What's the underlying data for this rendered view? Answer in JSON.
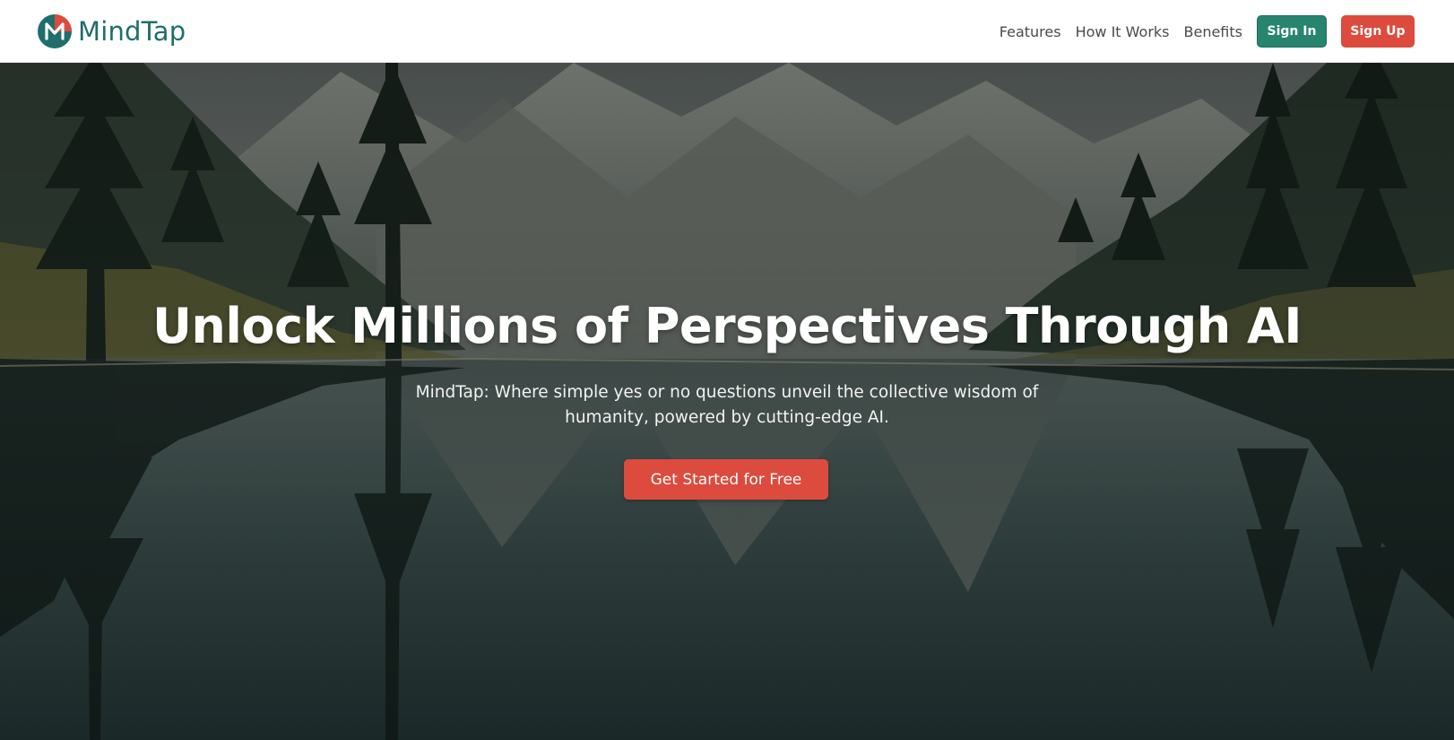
{
  "header": {
    "brand_name": "MindTap",
    "logo_letter": "M",
    "nav": {
      "features": "Features",
      "how_it_works": "How It Works",
      "benefits": "Benefits"
    },
    "sign_in": "Sign In",
    "sign_up": "Sign Up"
  },
  "hero": {
    "title": "Unlock Millions of Perspectives Through AI",
    "subtitle": "MindTap: Where simple yes or no questions unveil the collective wisdom of humanity, powered by cutting-edge AI.",
    "cta": "Get Started for Free"
  },
  "colors": {
    "brand_teal": "#1f6e6c",
    "sign_in_bg": "#27856f",
    "accent_red": "#dc4b3d"
  }
}
